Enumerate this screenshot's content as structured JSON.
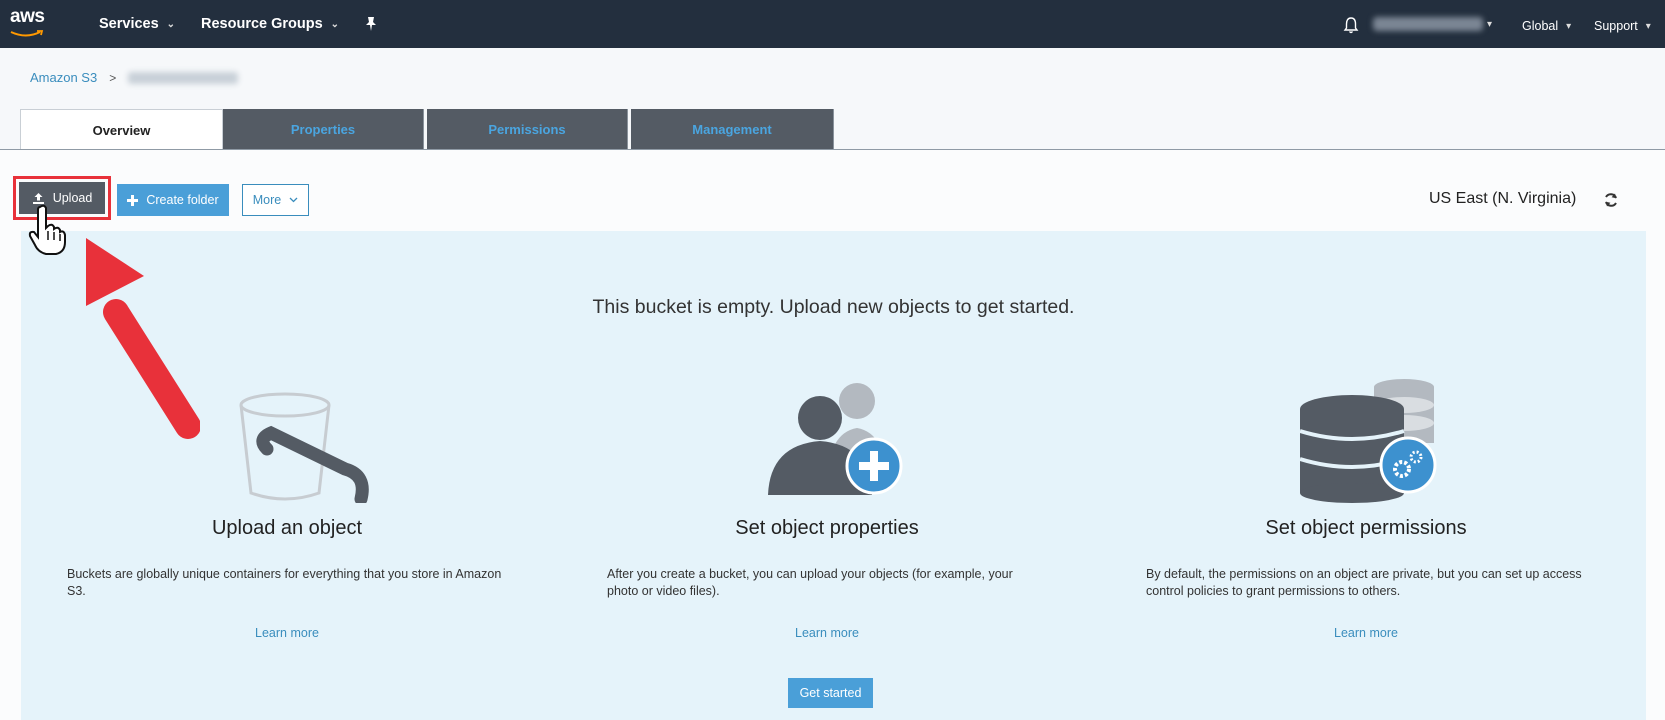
{
  "nav": {
    "logo": "aws",
    "services": "Services",
    "resource_groups": "Resource Groups",
    "pin_icon": "pin-icon",
    "bell_icon": "bell-icon",
    "global": "Global",
    "support": "Support"
  },
  "breadcrumb": {
    "root": "Amazon S3",
    "separator": ">"
  },
  "tabs": [
    {
      "label": "Overview",
      "active": true
    },
    {
      "label": "Properties",
      "active": false
    },
    {
      "label": "Permissions",
      "active": false
    },
    {
      "label": "Management",
      "active": false
    }
  ],
  "toolbar": {
    "upload": "Upload",
    "create_folder": "Create folder",
    "more": "More",
    "region": "US East (N. Virginia)"
  },
  "empty_state": {
    "heading": "This bucket is empty. Upload new objects to get started.",
    "columns": [
      {
        "icon": "bucket-icon",
        "title": "Upload an object",
        "description": "Buckets are globally unique containers for everything that you store in Amazon S3.",
        "link": "Learn more"
      },
      {
        "icon": "user-add-icon",
        "title": "Set object properties",
        "description": "After you create a bucket, you can upload your objects (for example, your photo or video files).",
        "link": "Learn more"
      },
      {
        "icon": "database-settings-icon",
        "title": "Set object permissions",
        "description": "By default, the permissions on an object are private, but you can set up access control policies to grant permissions to others.",
        "link": "Learn more"
      }
    ],
    "get_started": "Get started"
  },
  "colors": {
    "nav_bg": "#232f3e",
    "tab_inactive_bg": "#545b64",
    "tab_inactive_text": "#4aa5e0",
    "primary_blue": "#4a9fd8",
    "panel_bg": "#e5f3fa",
    "highlight_red": "#e8313a"
  }
}
